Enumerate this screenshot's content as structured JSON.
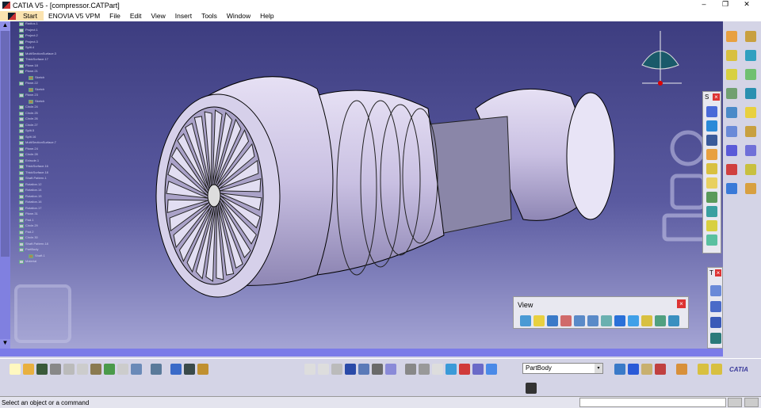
{
  "window": {
    "title": "CATIA V5 - [compressor.CATPart]",
    "minimize": "–",
    "restore": "❐",
    "close": "✕"
  },
  "menu": {
    "start": "Start",
    "items": [
      "ENOVIA V5 VPM",
      "File",
      "Edit",
      "View",
      "Insert",
      "Tools",
      "Window",
      "Help"
    ]
  },
  "tree": {
    "nodes": [
      "Radius.1",
      "Project.1",
      "Project.2",
      "Project.3",
      "Split.4",
      "MultiSectionSurface.3",
      "ThickSurface.17",
      "Plane.18",
      "Plane.21",
      "Sketch",
      "Plane.22",
      "Sketch",
      "Plane.23",
      "Sketch",
      "Circle.24",
      "Circle.25",
      "Circle.26",
      "Circle.27",
      "Split.5",
      "Split.16",
      "MultiSectionSurface.7",
      "Plane.24",
      "Circle.28",
      "Extrude.1",
      "ThickSurface.16",
      "ThickSurface.18",
      "Shaft.Pattern.1",
      "Rotation.12",
      "Rotation.14",
      "Rotation.15",
      "Rotation.16",
      "Rotation.17",
      "Plane.31",
      "Pad.1",
      "Circle.29",
      "Pad.2",
      "Circle.30",
      "Shaft.Pattern.18",
      "PartBody",
      "Shaft.1",
      "Material"
    ]
  },
  "view_toolbar": {
    "title": "View",
    "close": "×"
  },
  "small_toolbars": {
    "s_title": "S",
    "t_title": "T",
    "close": "×"
  },
  "bottom": {
    "part_select": "PartBody",
    "dropdown": "▾",
    "brand": "CATIA"
  },
  "status": {
    "message": "Select an object or a command"
  },
  "scroll": {
    "up": "▲",
    "down": "▼"
  }
}
